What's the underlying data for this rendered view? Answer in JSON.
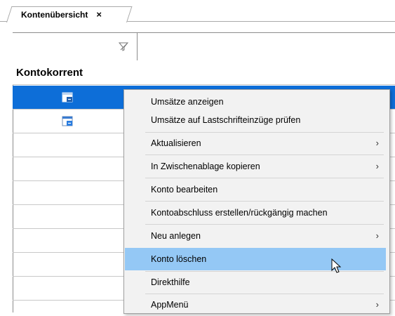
{
  "tab": {
    "label": "Kontenübersicht",
    "close": "×"
  },
  "group": {
    "title": "Kontokorrent"
  },
  "colors": {
    "selection": "#0d6ed8",
    "menu_highlight": "#94c8f5",
    "menu_bg": "#f2f2f2"
  },
  "icons": {
    "filter": "filter-icon",
    "account": "account-icon",
    "cursor": "mouse-cursor-icon"
  },
  "menu": {
    "item0": "Umsätze anzeigen",
    "item1": "Umsätze auf Lastschrifteinzüge prüfen",
    "item2": "Aktualisieren",
    "item3": "In Zwischenablage kopieren",
    "item4": "Konto bearbeiten",
    "item5": "Kontoabschluss erstellen/rückgängig machen",
    "item6": "Neu anlegen",
    "item7": "Konto löschen",
    "item8": "Direkthilfe",
    "item9": "AppMenü",
    "submenu_arrow": "›"
  }
}
